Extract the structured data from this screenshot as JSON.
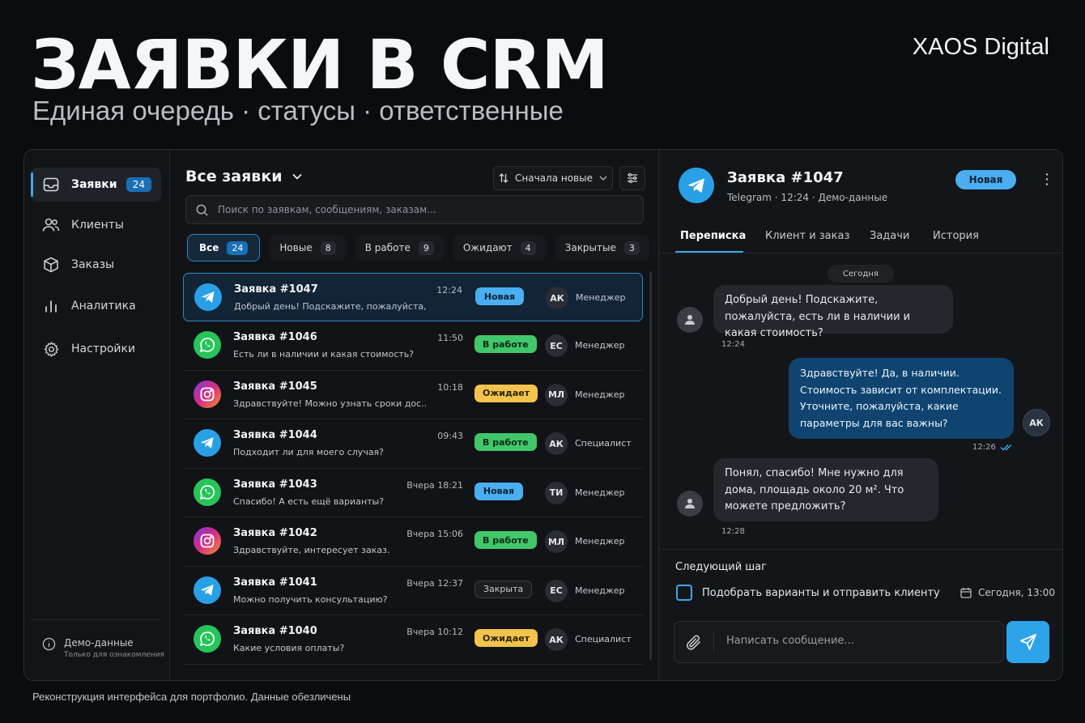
{
  "hero": {
    "title": "ЗАЯВКИ В CRM",
    "subtitle": "Единая очередь · статусы · ответственные",
    "brand": "XAOS Digital"
  },
  "footer": "Реконструкция интерфейса для портфолио. Данные обезличены",
  "sidebar": {
    "items": [
      {
        "label": "Заявки",
        "count": "24",
        "icon": "inbox-icon",
        "active": true
      },
      {
        "label": "Клиенты",
        "icon": "users-icon"
      },
      {
        "label": "Заказы",
        "icon": "box-icon"
      },
      {
        "label": "Аналитика",
        "icon": "bar-chart-icon"
      },
      {
        "label": "Настройки",
        "icon": "gear-icon"
      }
    ],
    "demo_title": "Демо-данные",
    "demo_sub": "Только для ознакомления"
  },
  "list": {
    "title": "Все заявки",
    "sort_label": "Сначала новые",
    "search_placeholder": "Поиск по заявкам, сообщениям, заказам...",
    "tabs": [
      {
        "label": "Все",
        "count": "24"
      },
      {
        "label": "Новые",
        "count": "8"
      },
      {
        "label": "В работе",
        "count": "9"
      },
      {
        "label": "Ожидают",
        "count": "4"
      },
      {
        "label": "Закрытые",
        "count": "3"
      }
    ],
    "rows": [
      {
        "title": "Заявка #1047",
        "time": "12:24",
        "msg": "Добрый день! Подскажите, пожалуйста, ...",
        "status": "Новая",
        "initials": "АК",
        "role": "Менеджер",
        "channel": "telegram"
      },
      {
        "title": "Заявка #1046",
        "time": "11:50",
        "msg": "Есть ли в наличии и какая стоимость?",
        "status": "В работе",
        "initials": "ЕС",
        "role": "Менеджер",
        "channel": "whatsapp"
      },
      {
        "title": "Заявка #1045",
        "time": "10:18",
        "msg": "Здравствуйте! Можно узнать сроки дос...",
        "status": "Ожидает",
        "initials": "МЛ",
        "role": "Менеджер",
        "channel": "instagram"
      },
      {
        "title": "Заявка #1044",
        "time": "09:43",
        "msg": "Подходит ли для моего случая?",
        "status": "В работе",
        "initials": "АК",
        "role": "Специалист",
        "channel": "telegram"
      },
      {
        "title": "Заявка #1043",
        "time": "Вчера 18:21",
        "msg": "Спасибо! А есть ещё варианты?",
        "status": "Новая",
        "initials": "ТИ",
        "role": "Менеджер",
        "channel": "whatsapp"
      },
      {
        "title": "Заявка #1042",
        "time": "Вчера 15:06",
        "msg": "Здравствуйте, интересует заказ.",
        "status": "В работе",
        "initials": "МЛ",
        "role": "Менеджер",
        "channel": "instagram"
      },
      {
        "title": "Заявка #1041",
        "time": "Вчера 12:37",
        "msg": "Можно получить консультацию?",
        "status": "Закрыта",
        "initials": "ЕС",
        "role": "Менеджер",
        "channel": "telegram"
      },
      {
        "title": "Заявка #1040",
        "time": "Вчера 10:12",
        "msg": "Какие условия оплаты?",
        "status": "Ожидает",
        "initials": "АК",
        "role": "Специалист",
        "channel": "whatsapp"
      }
    ]
  },
  "chat": {
    "title": "Заявка #1047",
    "meta": "Telegram · 12:24 · Демо-данные",
    "status": "Новая",
    "tabs": [
      "Переписка",
      "Клиент и заказ",
      "Задачи",
      "История"
    ],
    "date_chip": "Сегодня",
    "messages": [
      {
        "dir": "in",
        "text": "Добрый день! Подскажите, пожалуйста, есть ли в наличии и какая стоимость?",
        "time": "12:24"
      },
      {
        "dir": "out",
        "text": "Здравствуйте! Да, в наличии. Стоимость зависит от комплектации. Уточните, пожалуйста, какие параметры для вас важны?",
        "time": "12:26",
        "initials": "АК"
      },
      {
        "dir": "in",
        "text": "Понял, спасибо! Мне нужно для дома, площадь около 20 м². Что можете предложить?",
        "time": "12:28"
      }
    ],
    "next_step_title": "Следующий шаг",
    "next_step_task": "Подобрать варианты и отправить клиенту",
    "next_step_date": "Сегодня, 13:00",
    "compose_placeholder": "Написать сообщение..."
  },
  "colors": {
    "accent": "#2ea3ea",
    "status_new": "#4aaef0",
    "status_work": "#41c76a",
    "status_wait": "#f2c44c",
    "telegram": "#29a0e6",
    "whatsapp": "#25c55a"
  }
}
